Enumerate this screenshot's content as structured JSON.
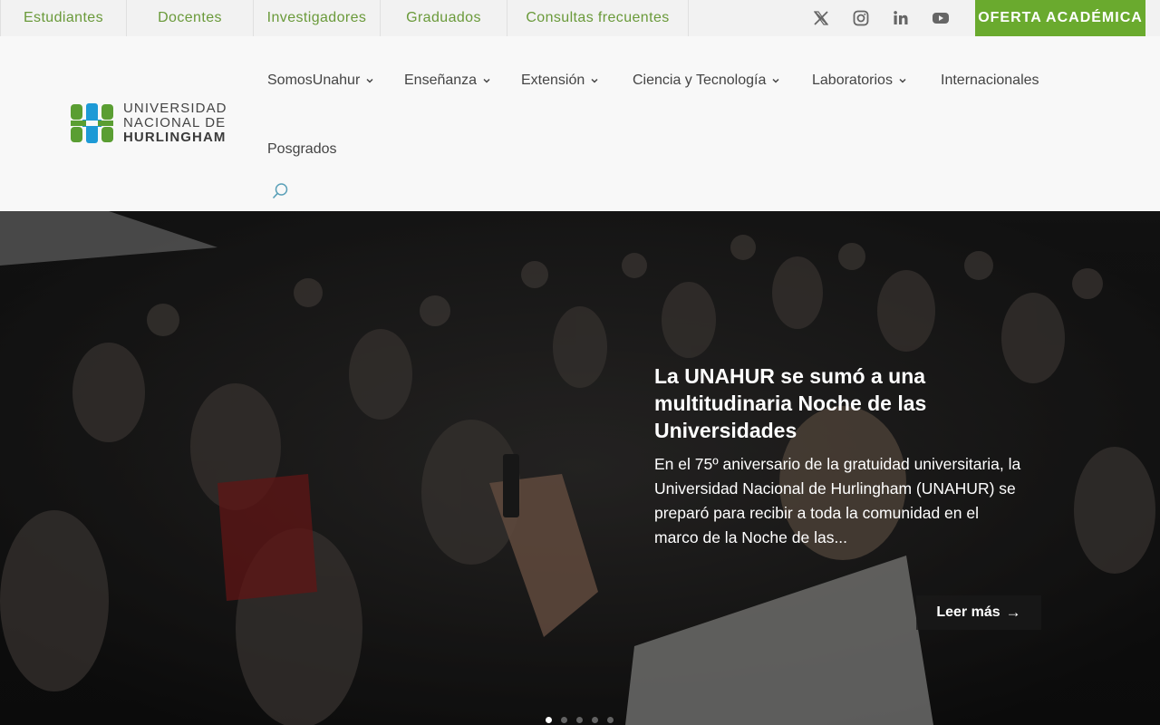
{
  "topbar": {
    "links": [
      "Estudiantes",
      "Docentes",
      "Investigadores",
      "Graduados",
      "Consultas frecuentes"
    ],
    "socials": [
      "x-icon",
      "instagram-icon",
      "linkedin-icon",
      "youtube-icon"
    ],
    "cta_label": "OFERTA ACADÉMICA"
  },
  "logo": {
    "line1": "UNIVERSIDAD",
    "line2": "NACIONAL DE",
    "line3": "HURLINGHAM"
  },
  "nav": {
    "items": [
      {
        "label": "SomosUnahur",
        "has_dropdown": true
      },
      {
        "label": "Enseñanza",
        "has_dropdown": true
      },
      {
        "label": "Extensión",
        "has_dropdown": true
      },
      {
        "label": "Ciencia y Tecnología",
        "has_dropdown": true
      },
      {
        "label": "Laboratorios",
        "has_dropdown": true
      },
      {
        "label": "Internacionales",
        "has_dropdown": false
      },
      {
        "label": "Posgrados",
        "has_dropdown": false
      }
    ],
    "search_icon": "search-icon"
  },
  "hero": {
    "title": "La UNAHUR se sumó a una multitudinaria Noche de las Universidades",
    "excerpt": "En el 75º aniversario de la gratuidad universitaria, la Universidad Nacional de Hurlingham (UNAHUR) se preparó para recibir a toda la comunidad en el marco de la Noche de las...",
    "read_more_label": "Leer más",
    "slide_count": 5,
    "active_slide": 1
  },
  "colors": {
    "brand_green": "#6aaa2e",
    "link_green": "#6a9a3a",
    "logo_blue": "#1d9ad6",
    "logo_green": "#5a9e32"
  }
}
